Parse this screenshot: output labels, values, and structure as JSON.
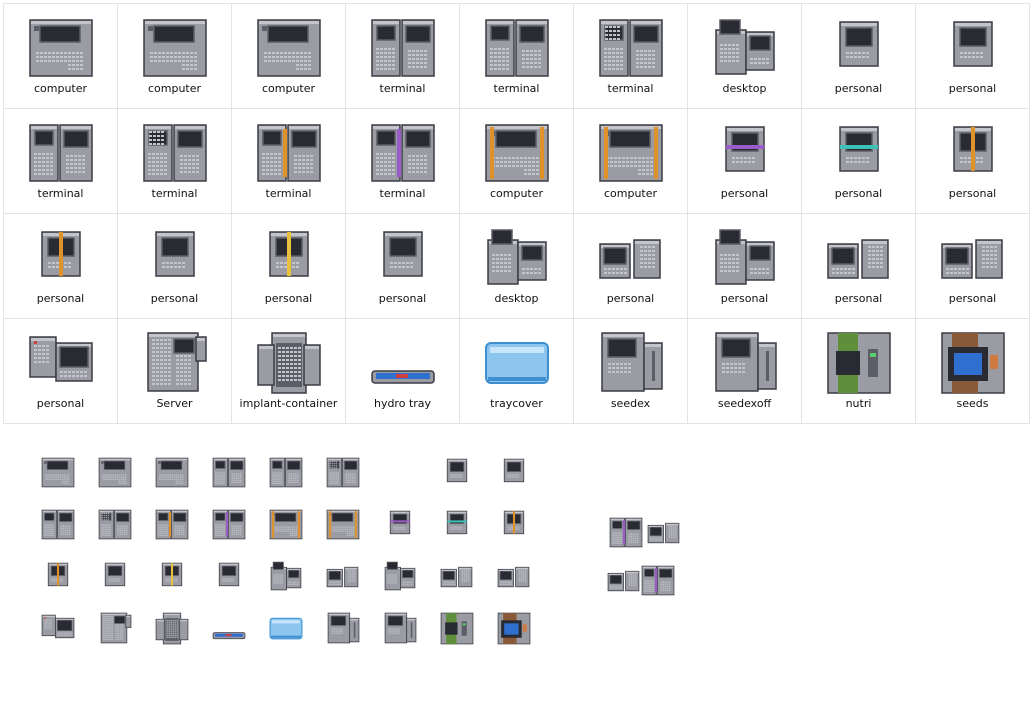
{
  "sprites": [
    {
      "label": "computer",
      "kind": "console"
    },
    {
      "label": "computer",
      "kind": "console"
    },
    {
      "label": "computer",
      "kind": "console"
    },
    {
      "label": "terminal",
      "kind": "terminal"
    },
    {
      "label": "terminal",
      "kind": "terminal"
    },
    {
      "label": "terminal",
      "kind": "terminal-alt"
    },
    {
      "label": "desktop",
      "kind": "desktop"
    },
    {
      "label": "personal",
      "kind": "personal"
    },
    {
      "label": "personal",
      "kind": "personal"
    },
    {
      "label": "terminal",
      "kind": "terminal"
    },
    {
      "label": "terminal",
      "kind": "terminal-alt"
    },
    {
      "label": "terminal",
      "kind": "terminal-orange"
    },
    {
      "label": "terminal",
      "kind": "terminal-purple"
    },
    {
      "label": "computer",
      "kind": "console-orange"
    },
    {
      "label": "computer",
      "kind": "console-orange"
    },
    {
      "label": "personal",
      "kind": "personal-purple"
    },
    {
      "label": "personal",
      "kind": "personal-teal"
    },
    {
      "label": "personal",
      "kind": "personal-orange"
    },
    {
      "label": "personal",
      "kind": "personal-orange"
    },
    {
      "label": "personal",
      "kind": "personal"
    },
    {
      "label": "personal",
      "kind": "personal-yellow"
    },
    {
      "label": "personal",
      "kind": "personal"
    },
    {
      "label": "desktop",
      "kind": "desktop"
    },
    {
      "label": "personal",
      "kind": "desktop-small"
    },
    {
      "label": "personal",
      "kind": "desktop"
    },
    {
      "label": "personal",
      "kind": "desktop-small"
    },
    {
      "label": "personal",
      "kind": "desktop-small"
    },
    {
      "label": "personal",
      "kind": "laptop"
    },
    {
      "label": "Server",
      "kind": "server"
    },
    {
      "label": "implant-container",
      "kind": "implant"
    },
    {
      "label": "hydro tray",
      "kind": "tray"
    },
    {
      "label": "traycover",
      "kind": "traycover"
    },
    {
      "label": "seedex",
      "kind": "seedex"
    },
    {
      "label": "seedexoff",
      "kind": "seedex"
    },
    {
      "label": "nutri",
      "kind": "nutri"
    },
    {
      "label": "seeds",
      "kind": "seeds"
    }
  ],
  "colors": {
    "metal": "#9a9ba3",
    "metal_light": "#c4c5cb",
    "metal_dark": "#5c5d66",
    "screen": "#2a2a33",
    "outline": "#3b3c44",
    "orange": "#e0922a",
    "purple": "#9a5cc8",
    "teal": "#3cc2b4",
    "yellow": "#e8c23a",
    "green": "#5f8f3a",
    "brown": "#8a5a38",
    "blue": "#2f6fd0",
    "glass": "#8cc6ef"
  },
  "preview_sprites": [
    "console",
    "console",
    "console",
    "terminal",
    "terminal",
    "terminal-alt",
    "personal",
    "personal",
    "terminal",
    "terminal-alt",
    "terminal-orange",
    "terminal-purple",
    "console-orange",
    "console-orange",
    "personal-purple",
    "personal-teal",
    "personal-orange",
    "personal-orange",
    "personal",
    "personal-yellow",
    "personal",
    "desktop",
    "desktop-small",
    "desktop",
    "desktop-small",
    "desktop-small",
    "laptop",
    "server",
    "implant",
    "tray",
    "traycover",
    "seedex",
    "seedex",
    "nutri",
    "seeds",
    "terminal-purple",
    "desktop-small",
    "desktop-small"
  ]
}
